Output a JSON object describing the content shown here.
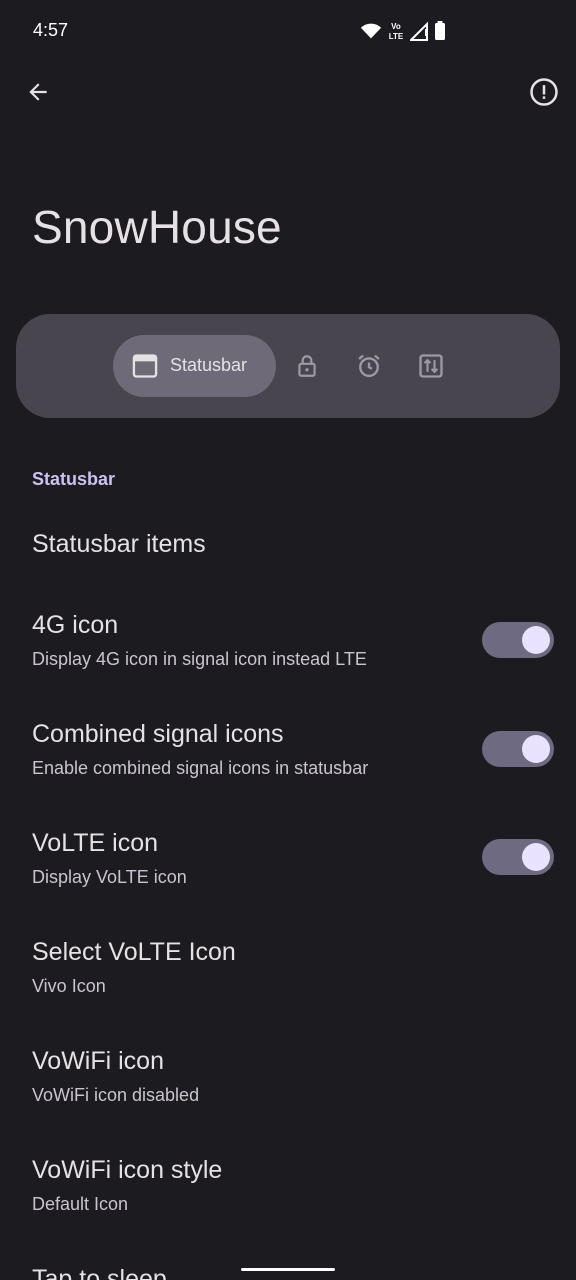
{
  "status_bar": {
    "time": "4:57",
    "icons": [
      "wifi-icon",
      "volte-icon",
      "signal-icon",
      "battery-icon"
    ],
    "volte_text": "VoLTE"
  },
  "top_bar": {
    "back_icon": "arrow-back-icon",
    "info_icon": "info-icon"
  },
  "page_title": "SnowHouse",
  "tabs": {
    "active_label": "Statusbar",
    "items": [
      "statusbar-icon",
      "lock-icon",
      "clock-icon",
      "quick-settings-icon"
    ]
  },
  "section": {
    "header": "Statusbar"
  },
  "preferences": [
    {
      "title": "Statusbar items",
      "summary": "",
      "toggle": null
    },
    {
      "title": "4G icon",
      "summary": "Display 4G icon in signal icon instead LTE",
      "toggle": true
    },
    {
      "title": "Combined signal icons",
      "summary": "Enable combined signal icons in statusbar",
      "toggle": true
    },
    {
      "title": "VoLTE icon",
      "summary": "Display VoLTE icon",
      "toggle": true
    },
    {
      "title": "Select VoLTE Icon",
      "summary": "Vivo Icon",
      "toggle": null
    },
    {
      "title": "VoWiFi icon",
      "summary": "VoWiFi icon disabled",
      "toggle": null
    },
    {
      "title": "VoWiFi icon style",
      "summary": "Default Icon",
      "toggle": null
    },
    {
      "title": "Tap to sleep",
      "summary": "",
      "toggle": null
    }
  ],
  "colors": {
    "background": "#1c1b1f",
    "accent": "#cdc1f2",
    "tab_container": "#49454f",
    "tab_active": "#6e6a77",
    "toggle_track": "#6e6a82",
    "toggle_thumb": "#e9e3ff"
  }
}
